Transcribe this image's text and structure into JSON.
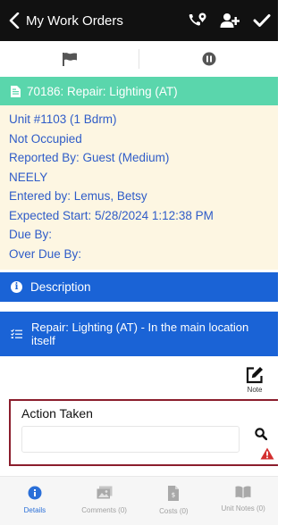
{
  "header": {
    "back_label": "My Work Orders"
  },
  "work_order": {
    "title": "70186: Repair: Lighting (AT)",
    "info_lines": [
      "Unit #1103 (1 Bdrm)",
      "Not Occupied",
      "Reported By: Guest  (Medium)",
      "NEELY",
      "Entered by: Lemus, Betsy",
      "Expected Start: 5/28/2024 1:12:38 PM",
      "Due By:",
      "Over Due By:"
    ]
  },
  "description": {
    "label": "Description"
  },
  "task": {
    "label": "Repair: Lighting (AT) - In the main location itself"
  },
  "note": {
    "label": "Note"
  },
  "action_taken": {
    "label": "Action Taken",
    "value": "",
    "placeholder": ""
  },
  "bottom_nav": {
    "tabs": [
      {
        "label": "Details",
        "icon": "info-icon",
        "active": true
      },
      {
        "label": "Comments (0)",
        "icon": "image-icon",
        "active": false
      },
      {
        "label": "Costs (0)",
        "icon": "receipt-icon",
        "active": false
      },
      {
        "label": "Unit Notes (0)",
        "icon": "book-icon",
        "active": false
      }
    ]
  },
  "colors": {
    "topbar": "#111111",
    "wo_header": "#5ad6ac",
    "info_bg": "#fdf6e2",
    "info_text": "#2f5cc8",
    "section_blue": "#1a63d6",
    "error_border": "#8b1d2c",
    "warning_red": "#d32f2f",
    "active_tab": "#2a6fd8"
  }
}
